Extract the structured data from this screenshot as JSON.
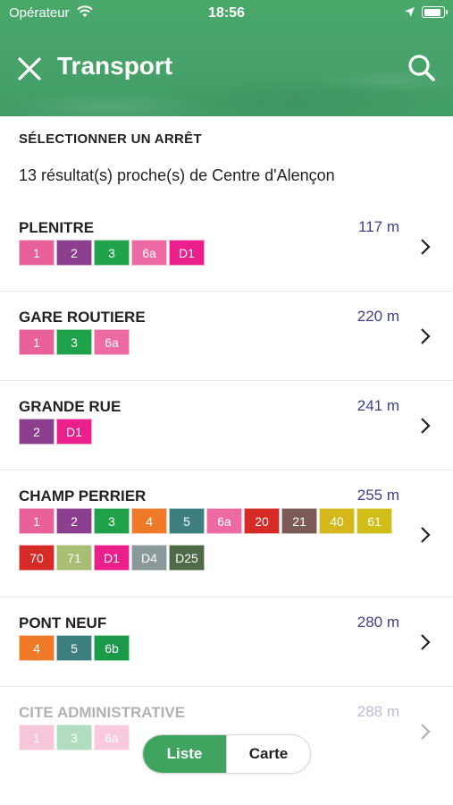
{
  "status_bar": {
    "carrier": "Opérateur",
    "time": "18:56"
  },
  "header": {
    "title": "Transport",
    "close_icon": "close-icon",
    "search_icon": "search-icon"
  },
  "section_title": "SÉLECTIONNER UN ARRÊT",
  "results_text": "13 résultat(s) proche(s) de Centre d'Alençon",
  "stops": [
    {
      "name": "PLENITRE",
      "distance": "117 m",
      "lines": [
        {
          "label": "1",
          "color": "#e8609a"
        },
        {
          "label": "2",
          "color": "#8b3f8e"
        },
        {
          "label": "3",
          "color": "#1fa24a"
        },
        {
          "label": "6a",
          "color": "#ee6aa2"
        },
        {
          "label": "D1",
          "color": "#ea1f8c"
        }
      ]
    },
    {
      "name": "GARE ROUTIERE",
      "distance": "220 m",
      "lines": [
        {
          "label": "1",
          "color": "#e8609a"
        },
        {
          "label": "3",
          "color": "#1fa24a"
        },
        {
          "label": "6a",
          "color": "#ee6aa2"
        }
      ]
    },
    {
      "name": "GRANDE RUE",
      "distance": "241 m",
      "lines": [
        {
          "label": "2",
          "color": "#8b3f8e"
        },
        {
          "label": "D1",
          "color": "#ea1f8c"
        }
      ]
    },
    {
      "name": "CHAMP PERRIER",
      "distance": "255 m",
      "lines": [
        {
          "label": "1",
          "color": "#e8609a"
        },
        {
          "label": "2",
          "color": "#8b3f8e"
        },
        {
          "label": "3",
          "color": "#1fa24a"
        },
        {
          "label": "4",
          "color": "#ef7b2a"
        },
        {
          "label": "5",
          "color": "#3d7f7e"
        },
        {
          "label": "6a",
          "color": "#ee6aa2"
        },
        {
          "label": "20",
          "color": "#d62a26"
        },
        {
          "label": "21",
          "color": "#7d5a55"
        },
        {
          "label": "40",
          "color": "#d5b81c"
        },
        {
          "label": "61",
          "color": "#d0bd17"
        },
        {
          "label": "70",
          "color": "#d62a26"
        },
        {
          "label": "71",
          "color": "#a7be73"
        },
        {
          "label": "D1",
          "color": "#ea1f8c"
        },
        {
          "label": "D4",
          "color": "#8a9a9a"
        },
        {
          "label": "D25",
          "color": "#4e6a47"
        }
      ]
    },
    {
      "name": "PONT NEUF",
      "distance": "280 m",
      "lines": [
        {
          "label": "4",
          "color": "#ef7b2a"
        },
        {
          "label": "5",
          "color": "#3d7f7e"
        },
        {
          "label": "6b",
          "color": "#1a9a48"
        }
      ]
    },
    {
      "name": "CITE ADMINISTRATIVE",
      "distance": "288 m",
      "lines": [
        {
          "label": "1",
          "color": "#e8609a"
        },
        {
          "label": "3",
          "color": "#1fa24a"
        },
        {
          "label": "6a",
          "color": "#ee6aa2"
        }
      ]
    }
  ],
  "toggle": {
    "list_label": "Liste",
    "map_label": "Carte"
  }
}
